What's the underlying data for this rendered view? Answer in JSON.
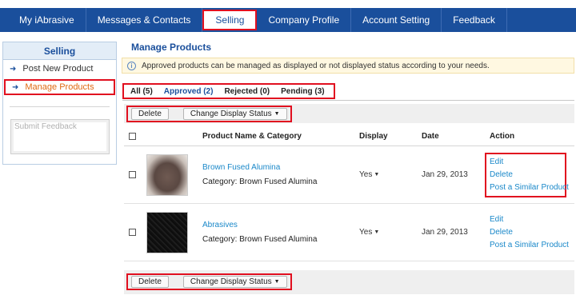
{
  "nav": {
    "tabs": [
      {
        "label": "My iAbrasive"
      },
      {
        "label": "Messages & Contacts"
      },
      {
        "label": "Selling"
      },
      {
        "label": "Company Profile"
      },
      {
        "label": "Account Setting"
      },
      {
        "label": "Feedback"
      }
    ],
    "active_tab": "Selling"
  },
  "sidebar": {
    "title": "Selling",
    "items": [
      {
        "label": "Post New Product",
        "icon": "arrow-right-icon"
      },
      {
        "label": "Manage Products",
        "icon": "arrow-right-icon",
        "active": true
      }
    ],
    "feedback_placeholder": "Submit Feedback"
  },
  "main": {
    "title": "Manage Products",
    "notice": "Approved products can be managed as displayed or not displayed status according to your needs.",
    "filters": [
      {
        "label": "All (5)"
      },
      {
        "label": "Approved (2)",
        "active": true
      },
      {
        "label": "Rejected (0)"
      },
      {
        "label": "Pending (3)"
      }
    ],
    "toolbar": {
      "delete_label": "Delete",
      "status_label": "Change Display Status"
    },
    "table": {
      "headers": {
        "name": "Product Name & Category",
        "display": "Display",
        "date": "Date",
        "action": "Action"
      },
      "rows": [
        {
          "name": "Brown Fused Alumina",
          "category": "Category: Brown Fused Alumina",
          "display": "Yes",
          "date": "Jan 29, 2013",
          "actions": [
            "Edit",
            "Delete",
            "Post a Similar Product"
          ]
        },
        {
          "name": "Abrasives",
          "category": "Category: Brown Fused Alumina",
          "display": "Yes",
          "date": "Jan 29, 2013",
          "actions": [
            "Edit",
            "Delete",
            "Post a Similar Product"
          ]
        }
      ]
    }
  },
  "colors": {
    "nav_bg": "#1a4f9c",
    "link": "#1a88c9",
    "highlight": "#e10f1f",
    "active_side": "#e06a12"
  }
}
